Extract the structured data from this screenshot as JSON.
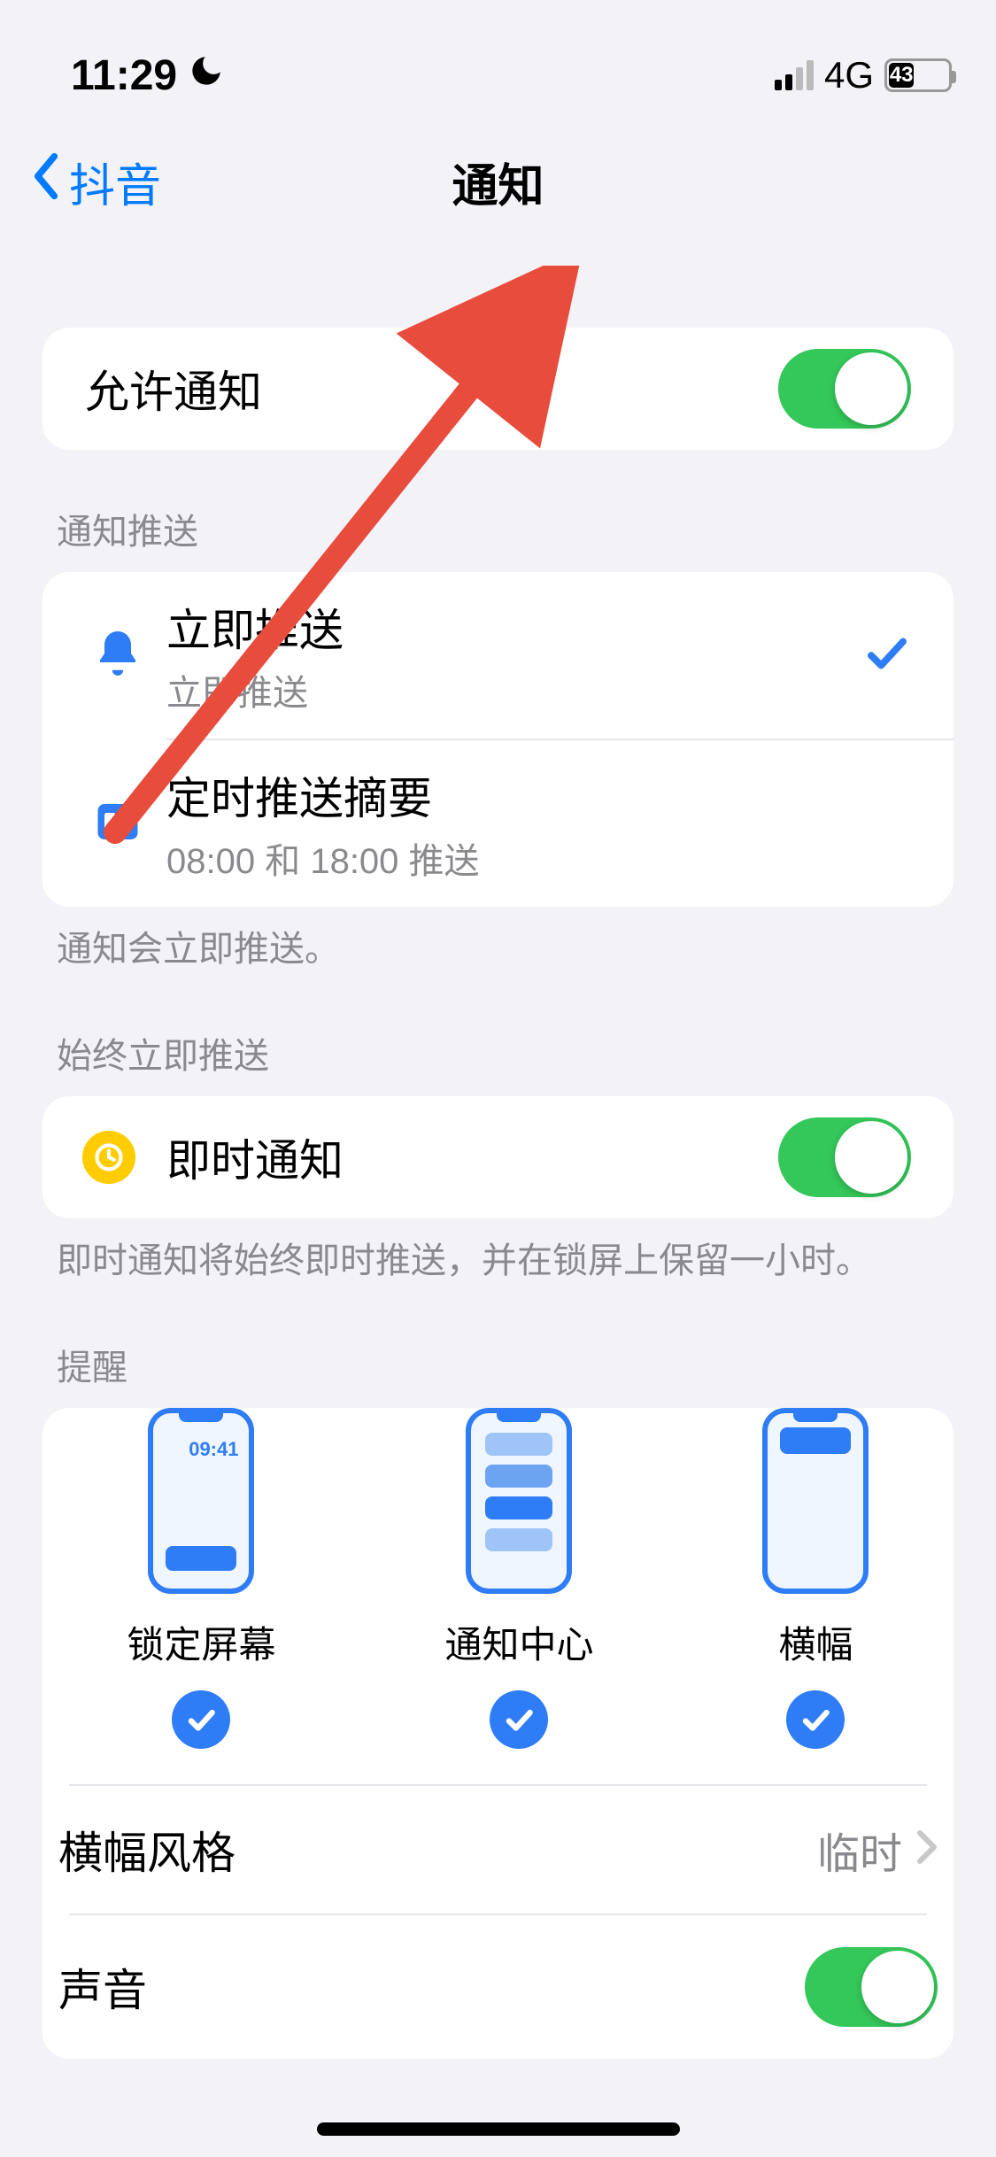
{
  "status": {
    "time": "11:29",
    "network": "4G",
    "battery_pct": 43
  },
  "nav": {
    "back_label": "抖音",
    "title": "通知"
  },
  "allow": {
    "label": "允许通知",
    "on": true
  },
  "delivery": {
    "header": "通知推送",
    "items": [
      {
        "title": "立即推送",
        "subtitle": "立即推送",
        "selected": true
      },
      {
        "title": "定时推送摘要",
        "subtitle": "08:00 和 18:00 推送",
        "selected": false
      }
    ],
    "footer": "通知会立即推送。"
  },
  "always": {
    "header": "始终立即推送",
    "row_label": "即时通知",
    "on": true,
    "footer": "即时通知将始终即时推送，并在锁屏上保留一小时。"
  },
  "alerts": {
    "header": "提醒",
    "options": [
      {
        "label": "锁定屏幕",
        "time_text": "09:41",
        "selected": true
      },
      {
        "label": "通知中心",
        "selected": true
      },
      {
        "label": "横幅",
        "selected": true
      }
    ],
    "banner_style": {
      "label": "横幅风格",
      "value": "临时"
    },
    "sound": {
      "label": "声音",
      "on": true
    }
  }
}
